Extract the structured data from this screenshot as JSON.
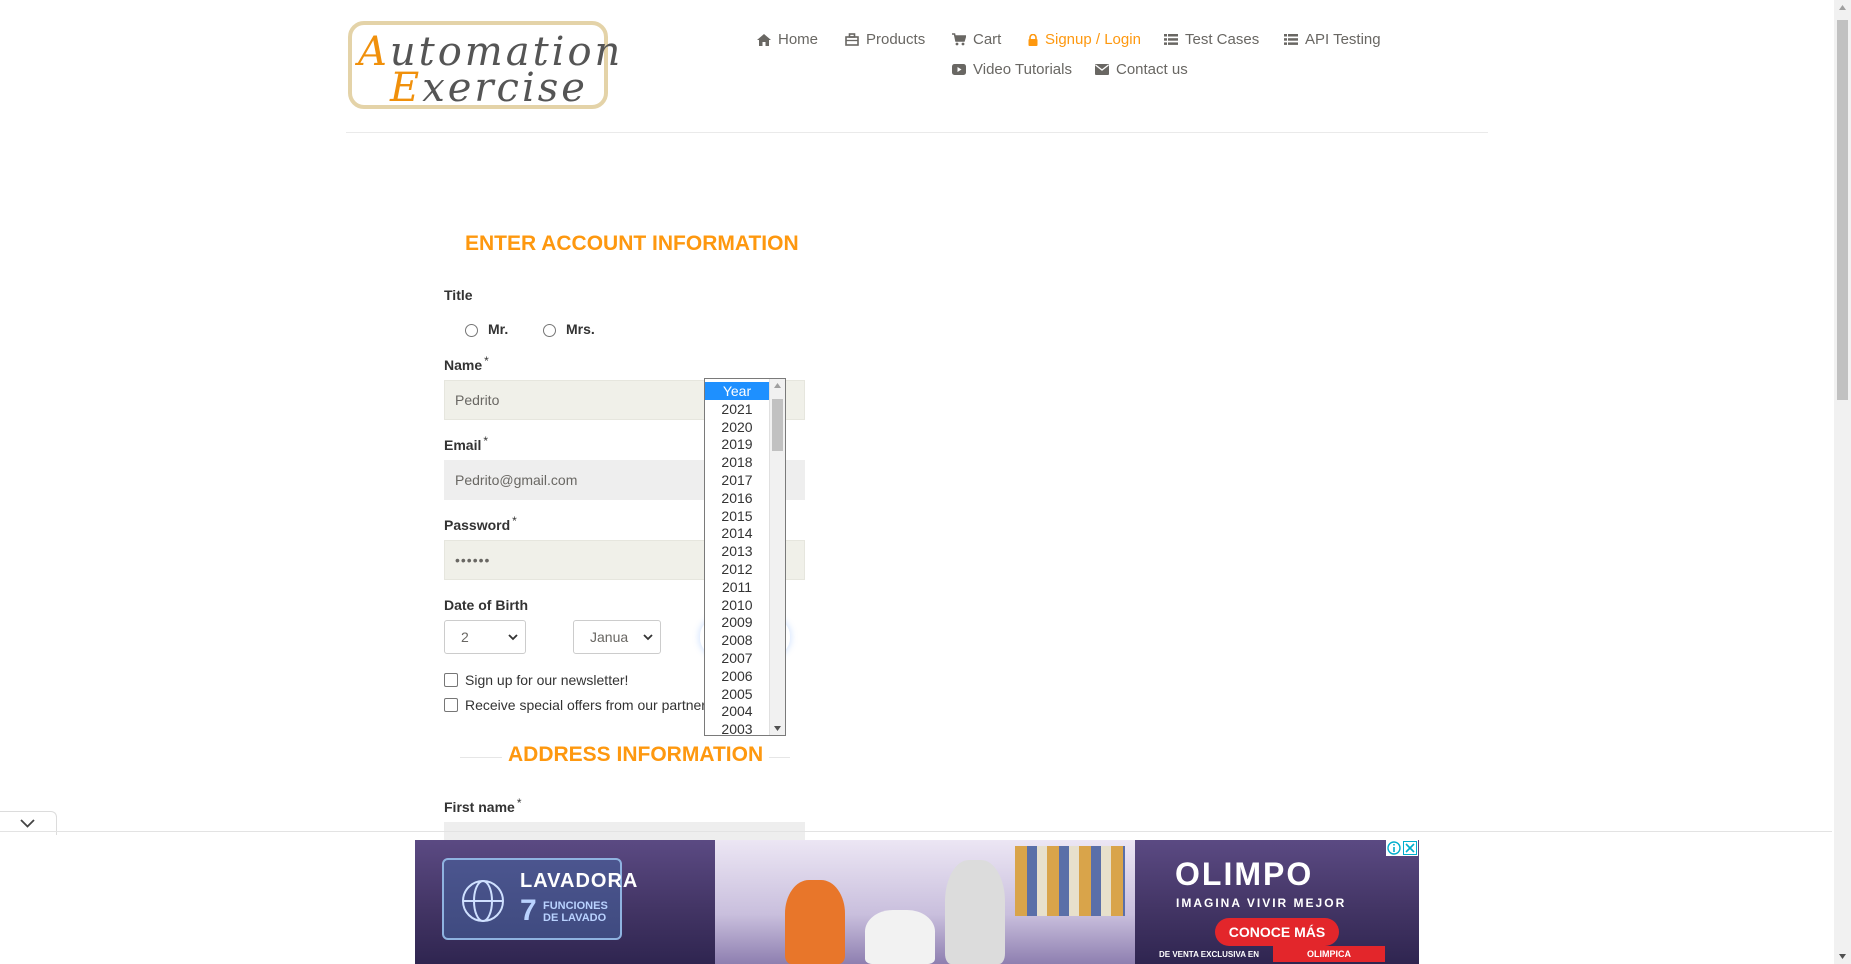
{
  "logo": {
    "line1_first": "A",
    "line1_rest": "utomation",
    "line2_first": "E",
    "line2_rest": "xercise"
  },
  "nav": {
    "items": [
      {
        "label": "Home",
        "icon": "home-icon"
      },
      {
        "label": "Products",
        "icon": "products-icon"
      },
      {
        "label": "Cart",
        "icon": "cart-icon"
      },
      {
        "label": "Signup / Login",
        "icon": "lock-icon",
        "active": true
      },
      {
        "label": "Test Cases",
        "icon": "list-icon"
      },
      {
        "label": "API Testing",
        "icon": "list-icon"
      },
      {
        "label": "Video Tutorials",
        "icon": "youtube-icon"
      },
      {
        "label": "Contact us",
        "icon": "envelope-icon"
      }
    ]
  },
  "form": {
    "account_title": "ENTER ACCOUNT INFORMATION",
    "title_label": "Title",
    "title_options": [
      "Mr.",
      "Mrs."
    ],
    "name_label": "Name",
    "name_value": "Pedrito",
    "email_label": "Email",
    "email_value": "Pedrito@gmail.com",
    "password_label": "Password",
    "password_value": "••••••",
    "dob_label": "Date of Birth",
    "day_value": "2",
    "month_value": "Janua",
    "newsletter_label": "Sign up for our newsletter!",
    "offers_label": "Receive special offers from our partner",
    "address_title": "ADDRESS INFORMATION",
    "first_name_label": "First name",
    "required_mark": "*"
  },
  "year_dropdown": {
    "options": [
      "Year",
      "2021",
      "2020",
      "2019",
      "2018",
      "2017",
      "2016",
      "2015",
      "2014",
      "2013",
      "2012",
      "2011",
      "2010",
      "2009",
      "2008",
      "2007",
      "2006",
      "2005",
      "2004",
      "2003"
    ],
    "selected": "Year"
  },
  "ad": {
    "box_title": "LAVADORA",
    "box_number": "7",
    "box_sub": "FUNCIONES DE LAVADO",
    "brand": "OLIMPO",
    "tagline": "IMAGINA VIVIR MEJOR",
    "cta": "CONOCE MÁS",
    "footer": "DE VENTA EXCLUSIVA EN",
    "footer_brand": "OLIMPICA"
  },
  "colors": {
    "accent": "#fe980f",
    "nav_text": "#696763",
    "field_bg": "#eeeeee",
    "selected_option": "#1e90ff"
  }
}
